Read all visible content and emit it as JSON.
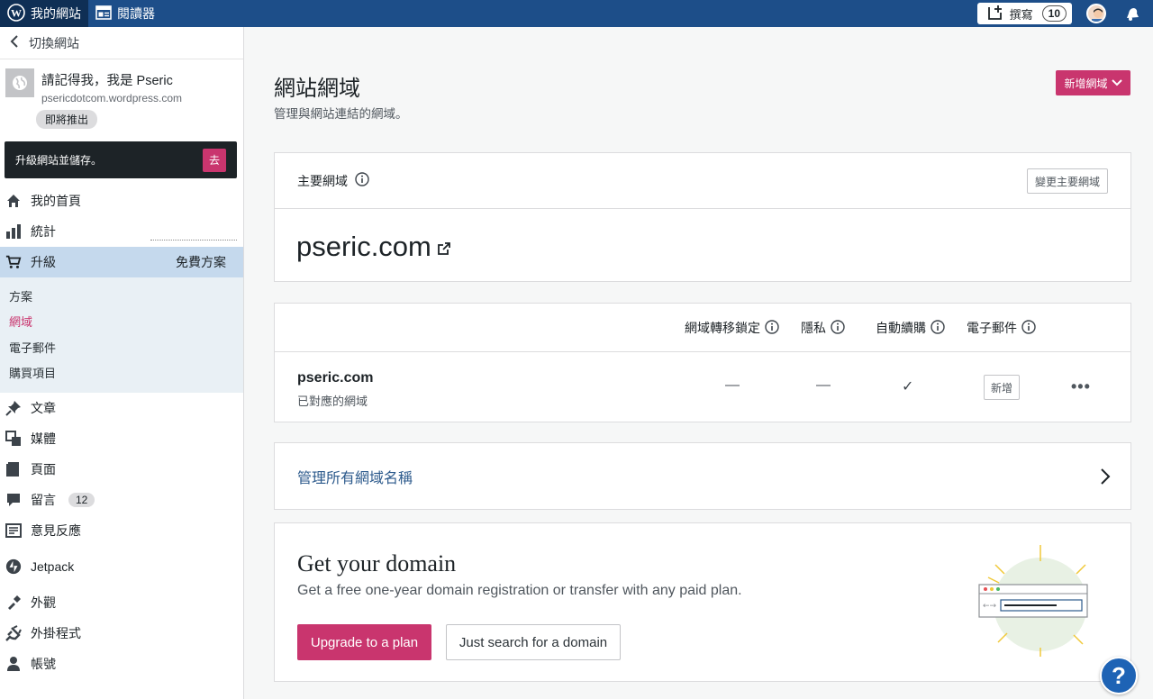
{
  "topbar": {
    "my_site": "我的網站",
    "reader": "閱讀器",
    "write_label": "撰寫",
    "write_count": "10"
  },
  "sidebar": {
    "switch_site": "切換網站",
    "site_name": "請記得我，我是 Pseric",
    "site_url": "psericdotcom.wordpress.com",
    "coming_soon": "即將推出",
    "upgrade_text": "升級網站並儲存。",
    "upgrade_go": "去",
    "items": [
      {
        "label": "我的首頁",
        "icon": "home-icon"
      },
      {
        "label": "統計",
        "icon": "stats-icon"
      },
      {
        "label": "升級",
        "icon": "cart-icon",
        "right": "免費方案"
      },
      {
        "label": "文章",
        "icon": "pin-icon"
      },
      {
        "label": "媒體",
        "icon": "media-icon"
      },
      {
        "label": "頁面",
        "icon": "pages-icon"
      },
      {
        "label": "留言",
        "icon": "comment-icon",
        "badge": "12"
      },
      {
        "label": "意見反應",
        "icon": "feedback-icon"
      },
      {
        "label": "Jetpack",
        "icon": "jetpack-icon"
      },
      {
        "label": "外觀",
        "icon": "appearance-icon"
      },
      {
        "label": "外掛程式",
        "icon": "plugins-icon"
      },
      {
        "label": "帳號",
        "icon": "user-icon"
      }
    ],
    "sub_items": [
      "方案",
      "網域",
      "電子郵件",
      "購買項目"
    ]
  },
  "main": {
    "title": "網站網域",
    "subtitle": "管理與網站連結的網域。",
    "add_domain": "新增網域",
    "primary_label": "主要網域",
    "change_primary": "變更主要網域",
    "primary_domain": "pseric.com",
    "columns": [
      "網域轉移鎖定",
      "隱私",
      "自動續購",
      "電子郵件"
    ],
    "row": {
      "domain": "pseric.com",
      "type": "已對應的網域",
      "transfer_lock": "—",
      "privacy": "—",
      "auto_renew": "✓",
      "email_button": "新增",
      "more": "•••"
    },
    "manage_all": "管理所有網域名稱",
    "promo": {
      "title": "Get your domain",
      "subtitle": "Get a free one-year domain registration or transfer with any paid plan.",
      "upgrade_button": "Upgrade to a plan",
      "search_button": "Just search for a domain"
    }
  },
  "help": "?",
  "colors": {
    "topbar": "#1d4e89",
    "accent": "#c9356e",
    "selected_nav": "#c5d9ed",
    "link": "#2c5a8c"
  }
}
